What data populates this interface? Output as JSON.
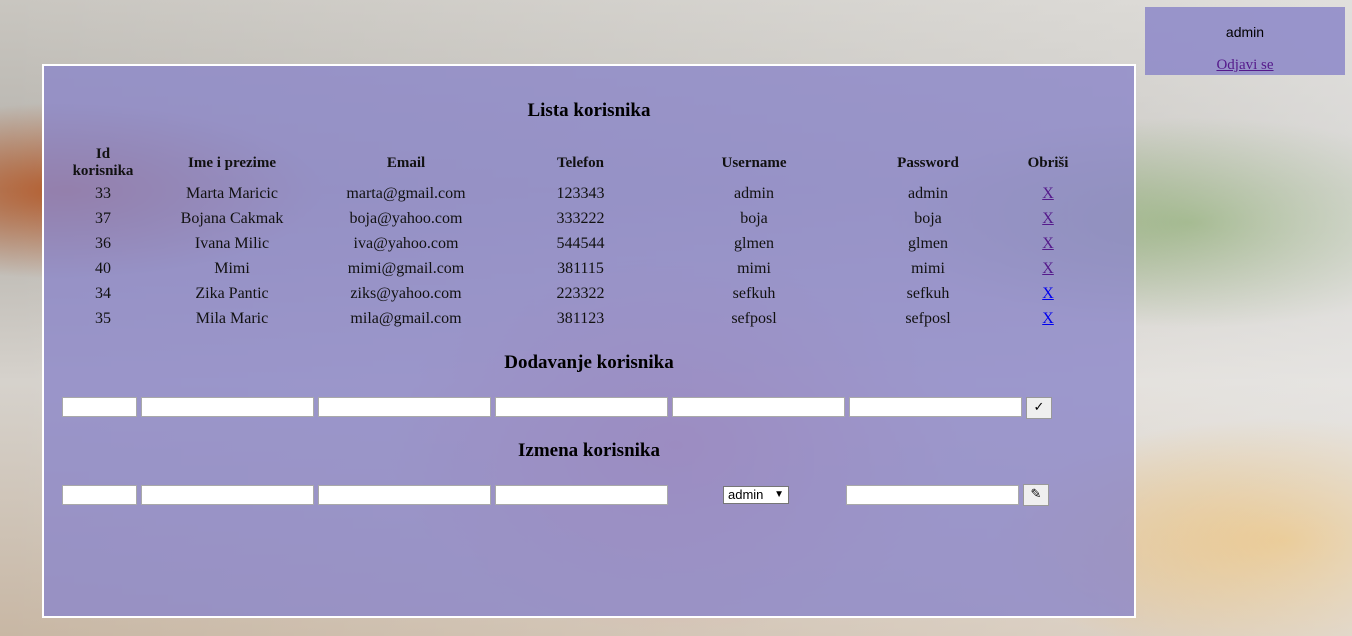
{
  "header": {
    "user": "admin",
    "logout_label": "Odjavi se"
  },
  "list": {
    "title": "Lista korisnika",
    "columns": [
      "Id korisnika",
      "Ime i prezime",
      "Email",
      "Telefon",
      "Username",
      "Password",
      "Obriši"
    ],
    "rows": [
      {
        "id": "33",
        "name": "Marta Maricic",
        "email": "marta@gmail.com",
        "phone": "123343",
        "username": "admin",
        "password": "admin",
        "delete": "X"
      },
      {
        "id": "37",
        "name": "Bojana Cakmak",
        "email": "boja@yahoo.com",
        "phone": "333222",
        "username": "boja",
        "password": "boja",
        "delete": "X"
      },
      {
        "id": "36",
        "name": "Ivana Milic",
        "email": "iva@yahoo.com",
        "phone": "544544",
        "username": "glmen",
        "password": "glmen",
        "delete": "X"
      },
      {
        "id": "40",
        "name": "Mimi",
        "email": "mimi@gmail.com",
        "phone": "381115",
        "username": "mimi",
        "password": "mimi",
        "delete": "X"
      },
      {
        "id": "34",
        "name": "Zika Pantic",
        "email": "ziks@yahoo.com",
        "phone": "223322",
        "username": "sefkuh",
        "password": "sefkuh",
        "delete": "X"
      },
      {
        "id": "35",
        "name": "Mila Maric",
        "email": "mila@gmail.com",
        "phone": "381123",
        "username": "sefposl",
        "password": "sefposl",
        "delete": "X"
      }
    ]
  },
  "add": {
    "title": "Dodavanje korisnika",
    "submit_icon": "✓"
  },
  "edit": {
    "title": "Izmena korisnika",
    "role_selected": "admin",
    "submit_icon": "✎"
  }
}
